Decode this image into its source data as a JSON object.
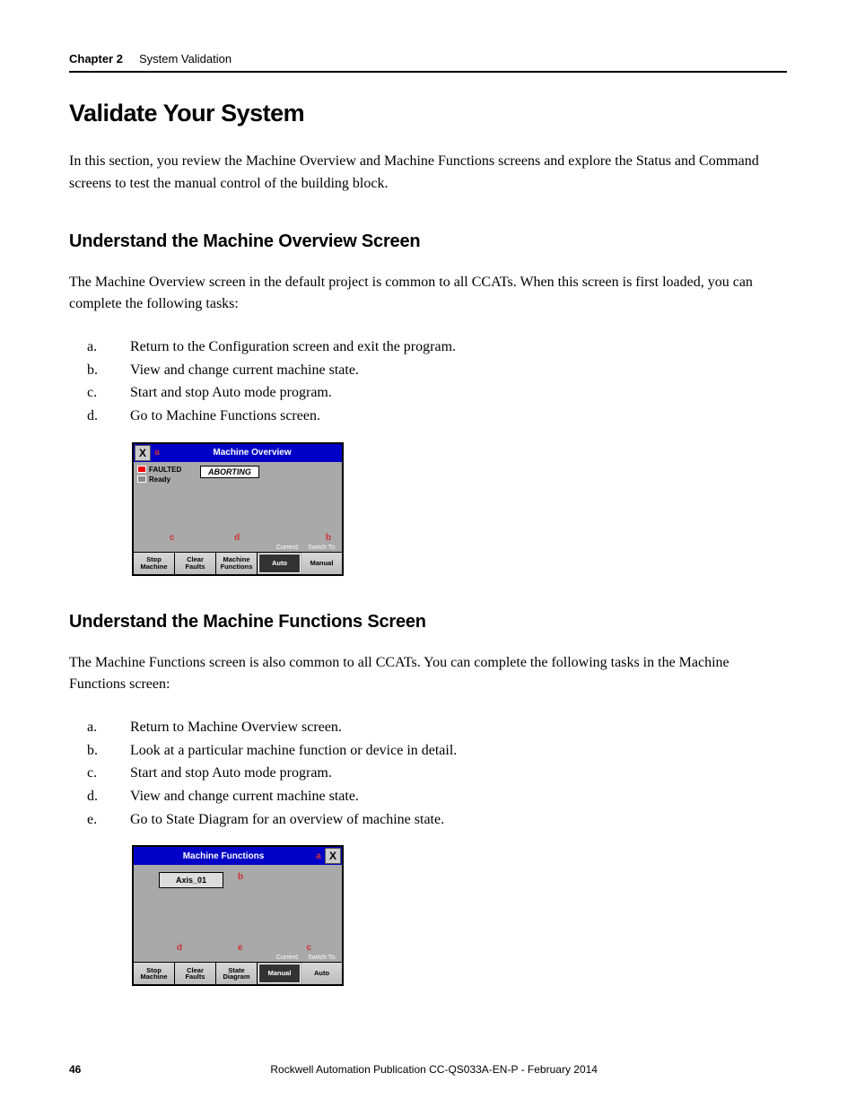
{
  "header": {
    "chapter": "Chapter 2",
    "title": "System Validation"
  },
  "section_title": "Validate Your System",
  "intro": "In this section, you review the Machine Overview and Machine Functions screens and explore the Status and Command screens to test the manual control of the building block.",
  "sub1": {
    "heading": "Understand the Machine Overview Screen",
    "para": "The Machine Overview screen in the default project is common to all CCATs. When this screen is first loaded, you can complete the following tasks:",
    "items": [
      "Return to the Configuration screen and exit the program.",
      "View and change current machine state.",
      "Start and stop Auto mode program.",
      "Go to Machine Functions screen."
    ]
  },
  "sub2": {
    "heading": "Understand the Machine Functions Screen",
    "para": "The Machine Functions screen is also common to all CCATs. You can complete the following tasks in the Machine Functions screen:",
    "items": [
      "Return to Machine Overview screen.",
      "Look at a particular machine function or device in detail.",
      "Start and stop Auto mode program.",
      "View and change current machine state.",
      "Go to State Diagram for an overview of machine state."
    ]
  },
  "hmi1": {
    "title": "Machine Overview",
    "x": "X",
    "a": "a",
    "faulted": "FAULTED",
    "ready": "Ready",
    "aborting": "ABORTING",
    "hints": {
      "c": "c",
      "d": "d",
      "b": "b"
    },
    "labels": {
      "current": "Current:",
      "switch": "Switch To:"
    },
    "buttons": {
      "stop": "Stop\nMachine",
      "clear": "Clear\nFaults",
      "functions": "Machine\nFunctions",
      "auto": "Auto",
      "manual": "Manual"
    }
  },
  "hmi2": {
    "title": "Machine Functions",
    "x": "X",
    "a": "a",
    "axis": "Axis_01",
    "hints": {
      "b": "b",
      "d": "d",
      "e": "e",
      "c": "c"
    },
    "labels": {
      "current": "Current:",
      "switch": "Switch To:"
    },
    "buttons": {
      "stop": "Stop\nMachine",
      "clear": "Clear\nFaults",
      "state": "State\nDiagram",
      "manual": "Manual",
      "auto": "Auto"
    }
  },
  "footer": {
    "page": "46",
    "pub": "Rockwell Automation Publication CC-QS033A-EN-P - February 2014"
  }
}
